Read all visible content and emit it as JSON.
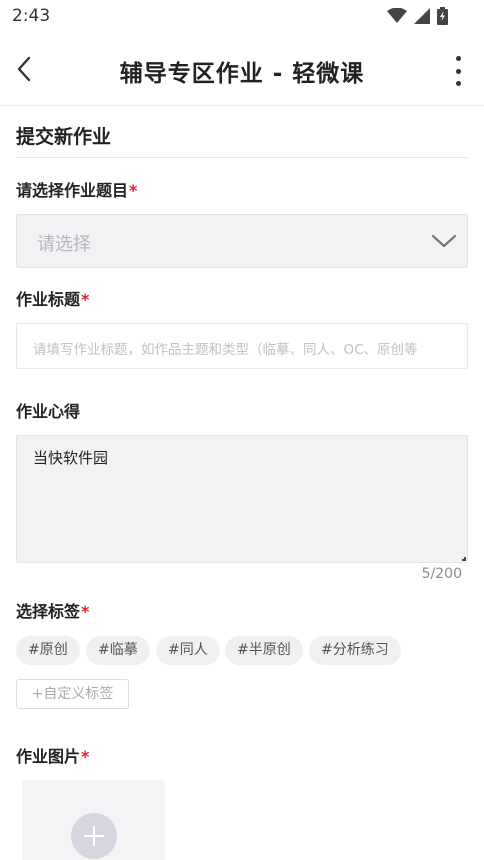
{
  "status_bar": {
    "time": "2:43",
    "icons": [
      "wifi-icon",
      "signal-icon",
      "battery-icon"
    ]
  },
  "app_bar": {
    "title": "辅导专区作业 - 轻微课",
    "back_icon": "chevron-left-icon",
    "menu_icon": "more-vert-icon"
  },
  "form": {
    "section_title": "提交新作业",
    "required_mark": "*",
    "topic": {
      "label": "请选择作业题目",
      "placeholder": "请选择"
    },
    "title_field": {
      "label": "作业标题",
      "placeholder": "请填写作业标题，如作品主题和类型（临摹、同人、OC、原创等"
    },
    "notes": {
      "label": "作业心得",
      "value": "当快软件园",
      "counter": "5/200"
    },
    "tags": {
      "label": "选择标签",
      "items": [
        "#原创",
        "#临摹",
        "#同人",
        "#半原创",
        "#分析练习"
      ],
      "custom_label": "+自定义标签"
    },
    "images": {
      "label": "作业图片",
      "add_icon": "plus-icon"
    }
  },
  "colors": {
    "required": "#e0202a",
    "input_fill": "#f2f2f4",
    "tag_fill": "#f0f0f2"
  }
}
